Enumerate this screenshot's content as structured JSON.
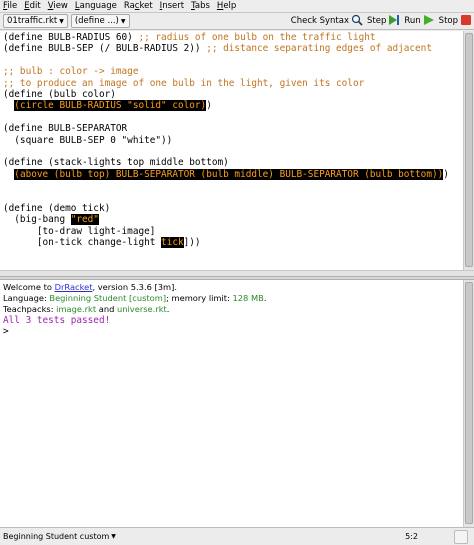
{
  "menubar": {
    "items": [
      {
        "label": "File",
        "mnemonic": "F"
      },
      {
        "label": "Edit",
        "mnemonic": "E"
      },
      {
        "label": "View",
        "mnemonic": "V"
      },
      {
        "label": "Language",
        "mnemonic": "L"
      },
      {
        "label": "Racket",
        "mnemonic": "c"
      },
      {
        "label": "Insert",
        "mnemonic": "I"
      },
      {
        "label": "Tabs",
        "mnemonic": "T"
      },
      {
        "label": "Help",
        "mnemonic": "H"
      }
    ]
  },
  "toolbar": {
    "file_label": "01traffic.rkt",
    "define_label": "(define ...)",
    "check_syntax_label": "Check Syntax",
    "step_label": "Step",
    "run_label": "Run",
    "stop_label": "Stop"
  },
  "editor": {
    "lines": [
      [
        {
          "t": "(define BULB-RADIUS 60) ",
          "c": ""
        },
        {
          "t": ";; radius of one bulb on the traffic light",
          "c": "cmt"
        }
      ],
      [
        {
          "t": "(define BULB-SEP (/ BULB-RADIUS 2)) ",
          "c": ""
        },
        {
          "t": ";; distance separating edges of adjacent",
          "c": "cmt"
        }
      ],
      [],
      [
        {
          "t": ";; bulb : color -> image",
          "c": "cmt"
        }
      ],
      [
        {
          "t": ";; to produce an image of one bulb in the light, given its color",
          "c": "cmt"
        }
      ],
      [
        {
          "t": "(define (bulb color)",
          "c": ""
        }
      ],
      [
        {
          "t": "  ",
          "c": ""
        },
        {
          "t": "(circle BULB-RADIUS \"solid\" color)",
          "c": "hl"
        },
        {
          "t": ")",
          "c": ""
        }
      ],
      [],
      [
        {
          "t": "(define BULB-SEPARATOR",
          "c": ""
        }
      ],
      [
        {
          "t": "  (square BULB-SEP 0 \"white\"))",
          "c": ""
        }
      ],
      [],
      [
        {
          "t": "(define (stack-lights top middle bottom)",
          "c": ""
        }
      ],
      [
        {
          "t": "  ",
          "c": ""
        },
        {
          "t": "(above (bulb top) BULB-SEPARATOR (bulb middle) BULB-SEPARATOR (bulb bottom))",
          "c": "hl"
        },
        {
          "t": ")",
          "c": ""
        }
      ],
      [],
      [],
      [
        {
          "t": "(define (demo tick)",
          "c": ""
        }
      ],
      [
        {
          "t": "  (big-bang ",
          "c": ""
        },
        {
          "t": "\"red\"",
          "c": "hl"
        }
      ],
      [
        {
          "t": "      [to-draw light-image]",
          "c": ""
        }
      ],
      [
        {
          "t": "      [on-tick change-light ",
          "c": ""
        },
        {
          "t": "tick",
          "c": "hl"
        },
        {
          "t": "]))",
          "c": ""
        }
      ]
    ]
  },
  "interactions": {
    "welcome_prefix": "Welcome to ",
    "welcome_link": "DrRacket",
    "welcome_suffix": ", version 5.3.6 [3m].",
    "language_prefix": "Language: ",
    "language_name": "Beginning Student [custom]",
    "language_mid": "; memory limit: ",
    "memory_limit": "128 MB",
    "language_end": ".",
    "teachpacks_prefix": "Teachpacks: ",
    "teachpack1": "image.rkt",
    "teachpacks_and": " and ",
    "teachpack2": "universe.rkt",
    "teachpacks_end": ".",
    "tests_result": "All 3 tests passed!",
    "prompt": ">"
  },
  "statusbar": {
    "language": "Beginning Student custom",
    "position": "5:2"
  },
  "colors": {
    "comment": "#c2741f",
    "highlight_bg": "#000000",
    "highlight_fg": "#ff9e1b",
    "link": "#2d2dd0",
    "green_text": "#2a8a2a",
    "tests_passed": "#9b27b0"
  }
}
